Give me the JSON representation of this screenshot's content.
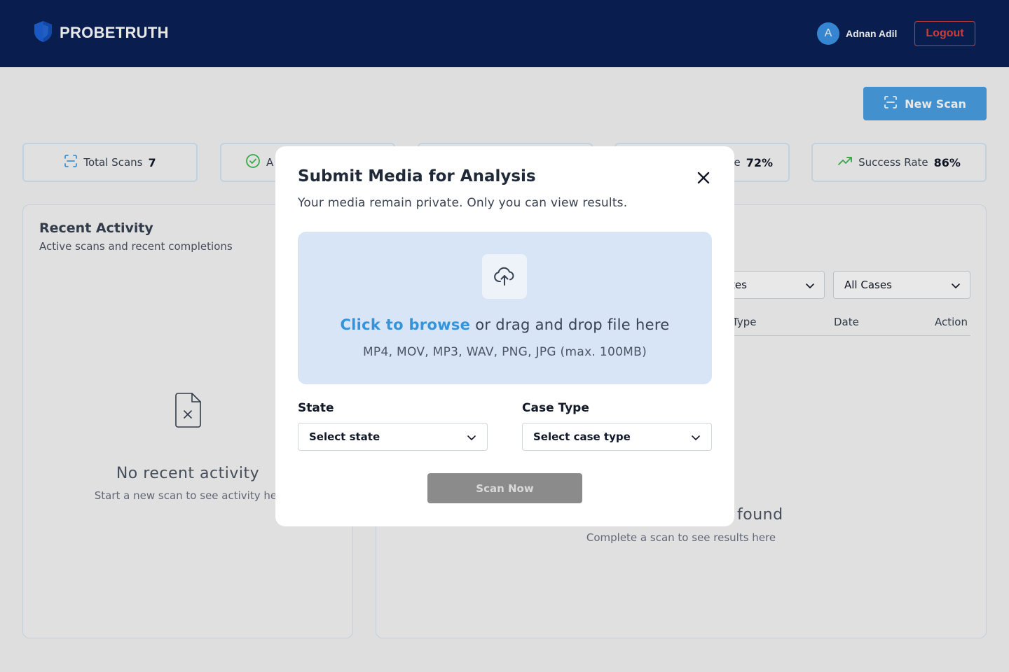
{
  "header": {
    "brand": "PROBETRUTH",
    "user_initial": "A",
    "user_name": "Adnan Adil",
    "logout_label": "Logout"
  },
  "toolbar": {
    "new_scan_label": "New Scan"
  },
  "stats": [
    {
      "label": "Total Scans",
      "value": "7",
      "icon": "scan-icon"
    },
    {
      "label": "A",
      "value": "",
      "icon": "check-circle-icon"
    },
    {
      "label": "",
      "value": "",
      "icon": ""
    },
    {
      "label": "e",
      "value": "72%",
      "icon": ""
    },
    {
      "label": "Success Rate",
      "value": "86%",
      "icon": "trend-up-icon"
    }
  ],
  "recent_activity": {
    "title": "Recent Activity",
    "subtitle": "Active scans and recent completions",
    "empty_title": "No recent activity",
    "empty_subtitle": "Start a new scan to see activity her"
  },
  "results": {
    "filter_dates": "tes",
    "filter_cases": "All Cases",
    "columns": [
      "Type",
      "Date",
      "Action"
    ],
    "empty_title": "found",
    "empty_subtitle": "Complete a scan to see results here"
  },
  "modal": {
    "title": "Submit Media for Analysis",
    "subtitle": "Your media remain private. Only you can view results.",
    "browse_link": "Click to browse",
    "browse_rest": " or drag and drop file here",
    "formats": "MP4, MOV, MP3, WAV, PNG, JPG (max. 100MB)",
    "state_label": "State",
    "state_placeholder": "Select state",
    "case_type_label": "Case Type",
    "case_type_placeholder": "Select case type",
    "scan_now_label": "Scan Now"
  },
  "colors": {
    "header_bg": "#0a2157",
    "accent": "#4a9fe3",
    "logout": "#e0453e",
    "link": "#3393db",
    "success": "#3fb950"
  }
}
